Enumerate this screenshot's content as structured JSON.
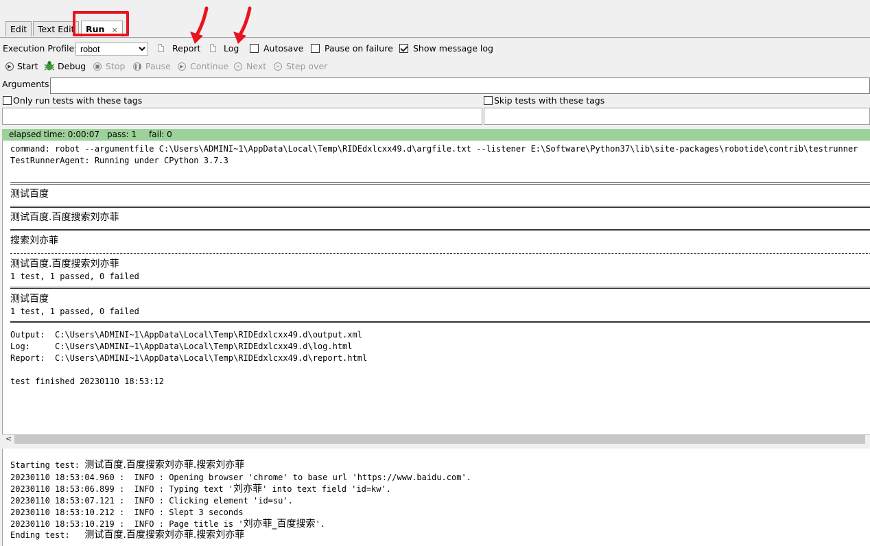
{
  "tabs": [
    {
      "label": "Edit"
    },
    {
      "label": "Text Edit"
    },
    {
      "label": "Run",
      "close": "×"
    }
  ],
  "toolbar": {
    "profile_label": "Execution Profile:",
    "profile_value": "robot",
    "report_label": "Report",
    "log_label": "Log",
    "autosave_label": "Autosave",
    "autosave_checked": false,
    "pause_failure_label": "Pause on failure",
    "pause_failure_checked": false,
    "show_log_label": "Show message log",
    "show_log_checked": true
  },
  "controls": {
    "start": "Start",
    "debug": "Debug",
    "stop": "Stop",
    "pause": "Pause",
    "continue": "Continue",
    "next": "Next",
    "step_over": "Step over"
  },
  "arguments": {
    "label": "Arguments:",
    "value": ""
  },
  "tags": {
    "only_run_label": "Only run tests with these tags",
    "skip_label": "Skip tests with these tags",
    "only_run_value": "",
    "skip_value": ""
  },
  "status": {
    "elapsed": "elapsed time: 0:00:07",
    "pass": "pass: 1",
    "fail": "fail: 0",
    "color": "#9cd19a"
  },
  "output_console": {
    "command": "command: robot --argumentfile C:\\Users\\ADMINI~1\\AppData\\Local\\Temp\\RIDEdxlcxx49.d\\argfile.txt --listener E:\\Software\\Python37\\lib\\site-packages\\robotide\\contrib\\testrunner",
    "agent": "TestRunnerAgent: Running under CPython 3.7.3",
    "suite1": "测试百度",
    "suite2": "测试百度.百度搜索刘亦菲",
    "testcase": "搜索刘亦菲",
    "suite2_end": "测试百度.百度搜索刘亦菲",
    "stats1": "1 test, 1 passed, 0 failed",
    "suite1_end": "测试百度",
    "stats2": "1 test, 1 passed, 0 failed",
    "output": "Output:  C:\\Users\\ADMINI~1\\AppData\\Local\\Temp\\RIDEdxlcxx49.d\\output.xml",
    "log": "Log:     C:\\Users\\ADMINI~1\\AppData\\Local\\Temp\\RIDEdxlcxx49.d\\log.html",
    "report": "Report:  C:\\Users\\ADMINI~1\\AppData\\Local\\Temp\\RIDEdxlcxx49.d\\report.html",
    "finished": "test finished 20230110 18:53:12"
  },
  "message_log": {
    "start_prefix": "Starting test: ",
    "start_name": "测试百度.百度搜索刘亦菲.搜索刘亦菲",
    "lines": [
      {
        "pre": "20230110 18:53:04.960 :  INFO : Opening browser 'chrome' to base url 'https://www.baidu.com'.",
        "cjk": "",
        "post": ""
      },
      {
        "pre": "20230110 18:53:06.899 :  INFO : Typing text '",
        "cjk": "刘亦菲",
        "post": "' into text field 'id=kw'."
      },
      {
        "pre": "20230110 18:53:07.121 :  INFO : Clicking element 'id=su'.",
        "cjk": "",
        "post": ""
      },
      {
        "pre": "20230110 18:53:10.212 :  INFO : Slept 3 seconds",
        "cjk": "",
        "post": ""
      },
      {
        "pre": "20230110 18:53:10.219 :  INFO : Page title is '",
        "cjk": "刘亦菲_百度搜索",
        "post": "'."
      }
    ],
    "end_prefix": "Ending test:   ",
    "end_name": "测试百度.百度搜索刘亦菲.搜索刘亦菲"
  },
  "annotation_color": "#e8141e"
}
